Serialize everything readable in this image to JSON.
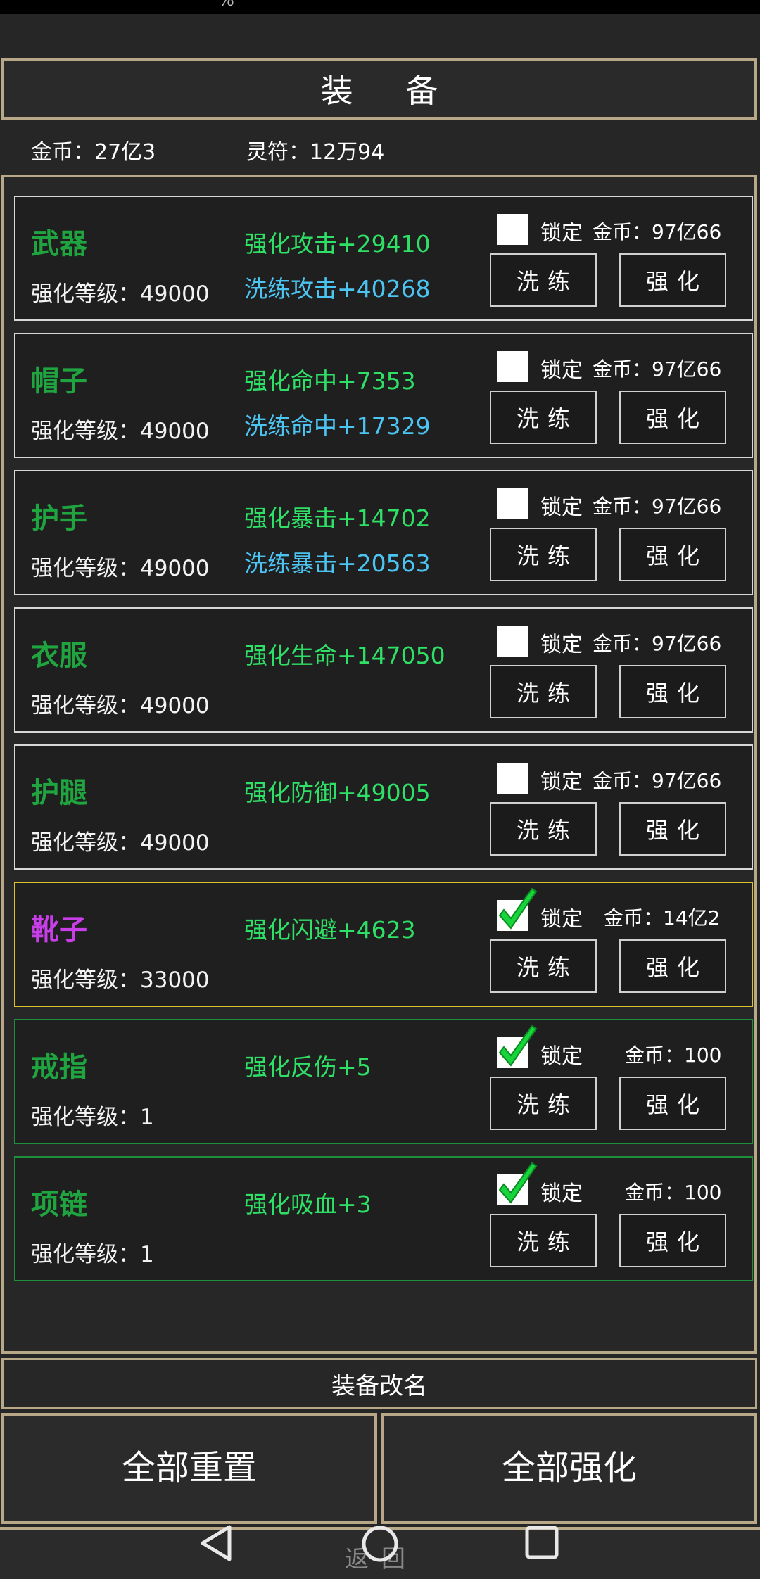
{
  "status": {
    "fragment": "%"
  },
  "title": "装 备",
  "currency": {
    "gold": "金币：27亿3",
    "talisman": "灵符：12万94"
  },
  "items": [
    {
      "name": "武器",
      "level": "强化等级：49000",
      "enhance": "强化攻击+29410",
      "refine": "洗练攻击+40268",
      "locked": false,
      "lock_label": "锁定",
      "cost": "金币：97亿66",
      "name_color": "#1fa43f",
      "border": "#d8d8d8",
      "refine_label": "洗练",
      "enhance_label": "强化"
    },
    {
      "name": "帽子",
      "level": "强化等级：49000",
      "enhance": "强化命中+7353",
      "refine": "洗练命中+17329",
      "locked": false,
      "lock_label": "锁定",
      "cost": "金币：97亿66",
      "name_color": "#1fa43f",
      "border": "#d8d8d8",
      "refine_label": "洗练",
      "enhance_label": "强化"
    },
    {
      "name": "护手",
      "level": "强化等级：49000",
      "enhance": "强化暴击+14702",
      "refine": "洗练暴击+20563",
      "locked": false,
      "lock_label": "锁定",
      "cost": "金币：97亿66",
      "name_color": "#1fa43f",
      "border": "#d8d8d8",
      "refine_label": "洗练",
      "enhance_label": "强化"
    },
    {
      "name": "衣服",
      "level": "强化等级：49000",
      "enhance": "强化生命+147050",
      "refine": "",
      "locked": false,
      "lock_label": "锁定",
      "cost": "金币：97亿66",
      "name_color": "#1fa43f",
      "border": "#d8d8d8",
      "refine_label": "洗练",
      "enhance_label": "强化"
    },
    {
      "name": "护腿",
      "level": "强化等级：49000",
      "enhance": "强化防御+49005",
      "refine": "",
      "locked": false,
      "lock_label": "锁定",
      "cost": "金币：97亿66",
      "name_color": "#1fa43f",
      "border": "#d8d8d8",
      "refine_label": "洗练",
      "enhance_label": "强化"
    },
    {
      "name": "靴子",
      "level": "强化等级：33000",
      "enhance": "强化闪避+4623",
      "refine": "",
      "locked": true,
      "lock_label": "锁定",
      "cost": "金币：14亿2",
      "name_color": "#c83ee8",
      "border": "#d9c22a",
      "refine_label": "洗练",
      "enhance_label": "强化"
    },
    {
      "name": "戒指",
      "level": "强化等级：1",
      "enhance": "强化反伤+5",
      "refine": "",
      "locked": true,
      "lock_label": "锁定",
      "cost": "金币：100",
      "name_color": "#1fa43f",
      "border": "#1e8f3a",
      "refine_label": "洗练",
      "enhance_label": "强化"
    },
    {
      "name": "项链",
      "level": "强化等级：1",
      "enhance": "强化吸血+3",
      "refine": "",
      "locked": true,
      "lock_label": "锁定",
      "cost": "金币：100",
      "name_color": "#1fa43f",
      "border": "#1e8f3a",
      "refine_label": "洗练",
      "enhance_label": "强化"
    }
  ],
  "rename_label": "装备改名",
  "reset_all_label": "全部重置",
  "enhance_all_label": "全部强化",
  "back_label": "返回",
  "colors": {
    "frame": "#b8a888",
    "enhance_stat": "#2fe066",
    "refine_stat": "#4cc4f2",
    "check": "#16d43a"
  }
}
